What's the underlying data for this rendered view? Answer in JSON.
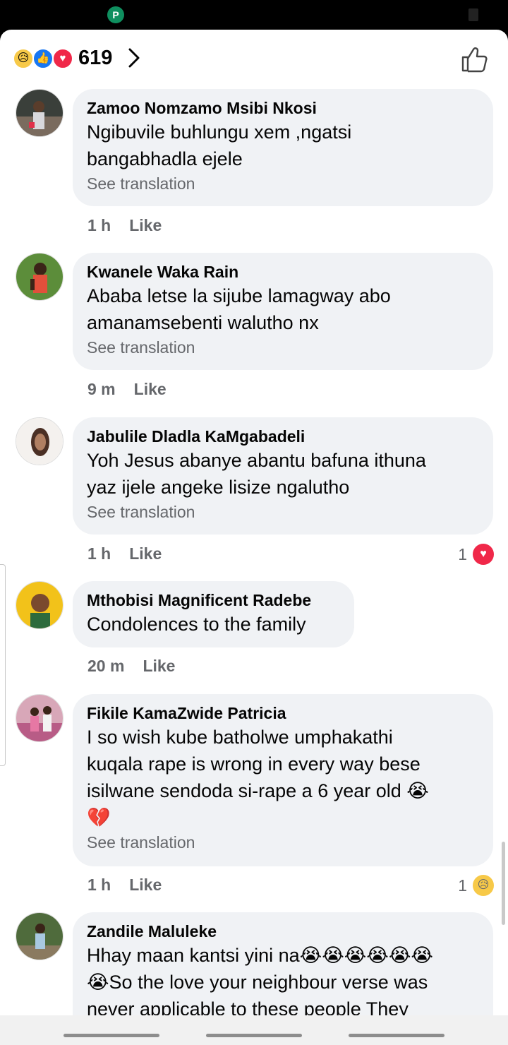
{
  "reactions": {
    "count": "619",
    "icons": [
      "sad-react-icon",
      "like-react-icon",
      "love-react-icon"
    ]
  },
  "comments": [
    {
      "author": "Zamoo Nomzamo Msibi Nkosi",
      "text_lines": [
        "Ngibuvile buhlungu xem ,ngatsi",
        "bangabhadla ejele"
      ],
      "translate": "See translation",
      "time": "1 h",
      "like": "Like"
    },
    {
      "author": "Kwanele Waka Rain",
      "text_lines": [
        "Ababa letse la sijube lamagway abo",
        "amanamsebenti walutho nx"
      ],
      "translate": "See translation",
      "time": "9 m",
      "like": "Like"
    },
    {
      "author": "Jabulile Dladla KaMgabadeli",
      "text_lines": [
        "Yoh Jesus abanye abantu bafuna ithuna",
        "yaz ijele angeke lisize ngalutho"
      ],
      "translate": "See translation",
      "time": "1 h",
      "like": "Like",
      "reaction_count": "1",
      "reaction_icon": "heart-reaction-icon"
    },
    {
      "author": "Mthobisi Magnificent Radebe",
      "text_lines": [
        "Condolences to the family"
      ],
      "time": "20 m",
      "like": "Like"
    },
    {
      "author": "Fikile KamaZwide Patricia",
      "text_lines": [
        "I so wish kube batholwe umphakathi",
        "kuqala rape is wrong in every way bese",
        "isilwane sendoda si-rape a 6 year old 😭",
        "💔"
      ],
      "translate": "See translation",
      "time": "1 h",
      "like": "Like",
      "reaction_count": "1",
      "reaction_icon": "sad-reaction-icon"
    },
    {
      "author": "Zandile Maluleke",
      "text_lines": [
        "Hhay maan kantsi yini na😭😭😭😭😭😭",
        "😭So the love your neighbour verse was",
        "never applicable to these people They"
      ]
    }
  ],
  "colors": {
    "bubble": "#f0f2f5",
    "meta": "#65676b",
    "like_blue": "#1877f2",
    "love_red": "#f02849",
    "sad_yellow": "#f7c948"
  }
}
